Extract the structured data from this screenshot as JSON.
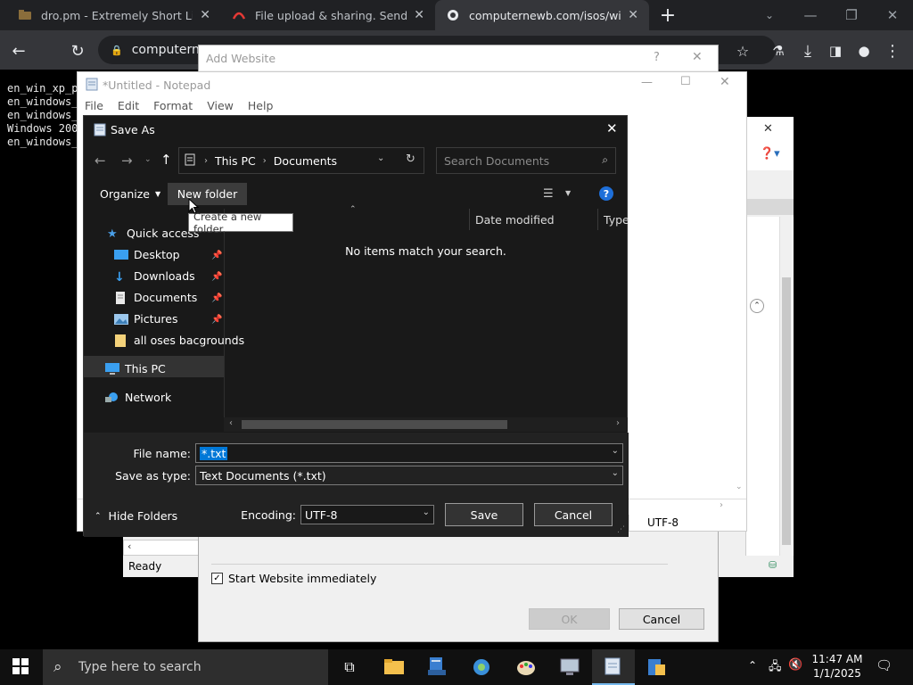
{
  "browser": {
    "tabs": [
      {
        "title": "dro.pm - Extremely Short Links",
        "active": false
      },
      {
        "title": "File upload & sharing. Send larg",
        "active": false
      },
      {
        "title": "computernewb.com/isos/windo",
        "active": true
      }
    ],
    "new_tab_glyph": "+",
    "address": "computernew"
  },
  "terminal": {
    "lines": [
      "en_win_xp_p",
      "en_windows_",
      "en_windows_",
      "Windows 200",
      "en_windows_"
    ]
  },
  "add_website": {
    "title": "Add Website",
    "help_glyph": "?",
    "start_immediately_label": "Start Website immediately",
    "start_immediately_checked": true,
    "ok_label": "OK",
    "cancel_label": "Cancel"
  },
  "iis": {
    "status_ready": "Ready"
  },
  "notepad": {
    "title": "*Untitled - Notepad",
    "menu": [
      "File",
      "Edit",
      "Format",
      "View",
      "Help"
    ],
    "encoding_status": "UTF-8"
  },
  "save_as": {
    "title": "Save As",
    "breadcrumb": [
      "This PC",
      "Documents"
    ],
    "search_placeholder": "Search Documents",
    "organize_label": "Organize",
    "new_folder_label": "New folder",
    "tooltip": "Create a new folder.",
    "columns": [
      "Date modified",
      "Type"
    ],
    "empty_message": "No items match your search.",
    "nav": {
      "quick_access": "Quick access",
      "items": [
        {
          "label": "Desktop",
          "pinned": true
        },
        {
          "label": "Downloads",
          "pinned": true
        },
        {
          "label": "Documents",
          "pinned": true
        },
        {
          "label": "Pictures",
          "pinned": true
        },
        {
          "label": "all oses bacgrounds",
          "pinned": false
        }
      ],
      "this_pc": "This PC",
      "network": "Network"
    },
    "file_name_label": "File name:",
    "file_name_value": "*.txt",
    "save_type_label": "Save as type:",
    "save_type_value": "Text Documents (*.txt)",
    "encoding_label": "Encoding:",
    "encoding_value": "UTF-8",
    "hide_folders_label": "Hide Folders",
    "save_label": "Save",
    "cancel_label": "Cancel"
  },
  "taskbar": {
    "search_placeholder": "Type here to search",
    "time": "11:47 AM",
    "date": "1/1/2025"
  },
  "colors": {
    "chrome_dark": "#202124",
    "dialog_bg": "#191919",
    "accent_blue": "#0078d7"
  }
}
